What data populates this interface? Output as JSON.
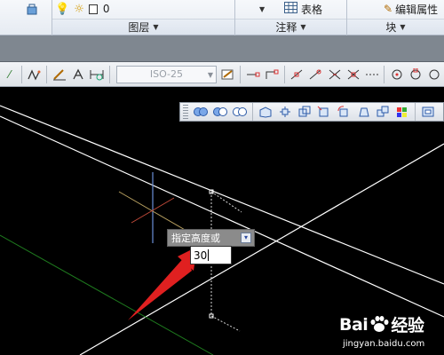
{
  "ribbon": {
    "layer_value": "0",
    "layer_panel_label": "图层",
    "annotation_panel_label": "注释",
    "table_label": "表格",
    "block_panel_label": "块",
    "edit_attr_label": "编辑属性"
  },
  "toolbar": {
    "dimstyle_value": "ISO-25"
  },
  "command": {
    "prompt": "指定高度或",
    "input_value": "30"
  },
  "watermark": {
    "brand_left": "Bai",
    "brand_right": "经验",
    "url": "jingyan.baidu.com"
  },
  "colors": {
    "canvas_bg": "#000000",
    "line_white": "#ffffff",
    "line_green": "#1e7a1e",
    "arrow_red": "#e02020"
  }
}
